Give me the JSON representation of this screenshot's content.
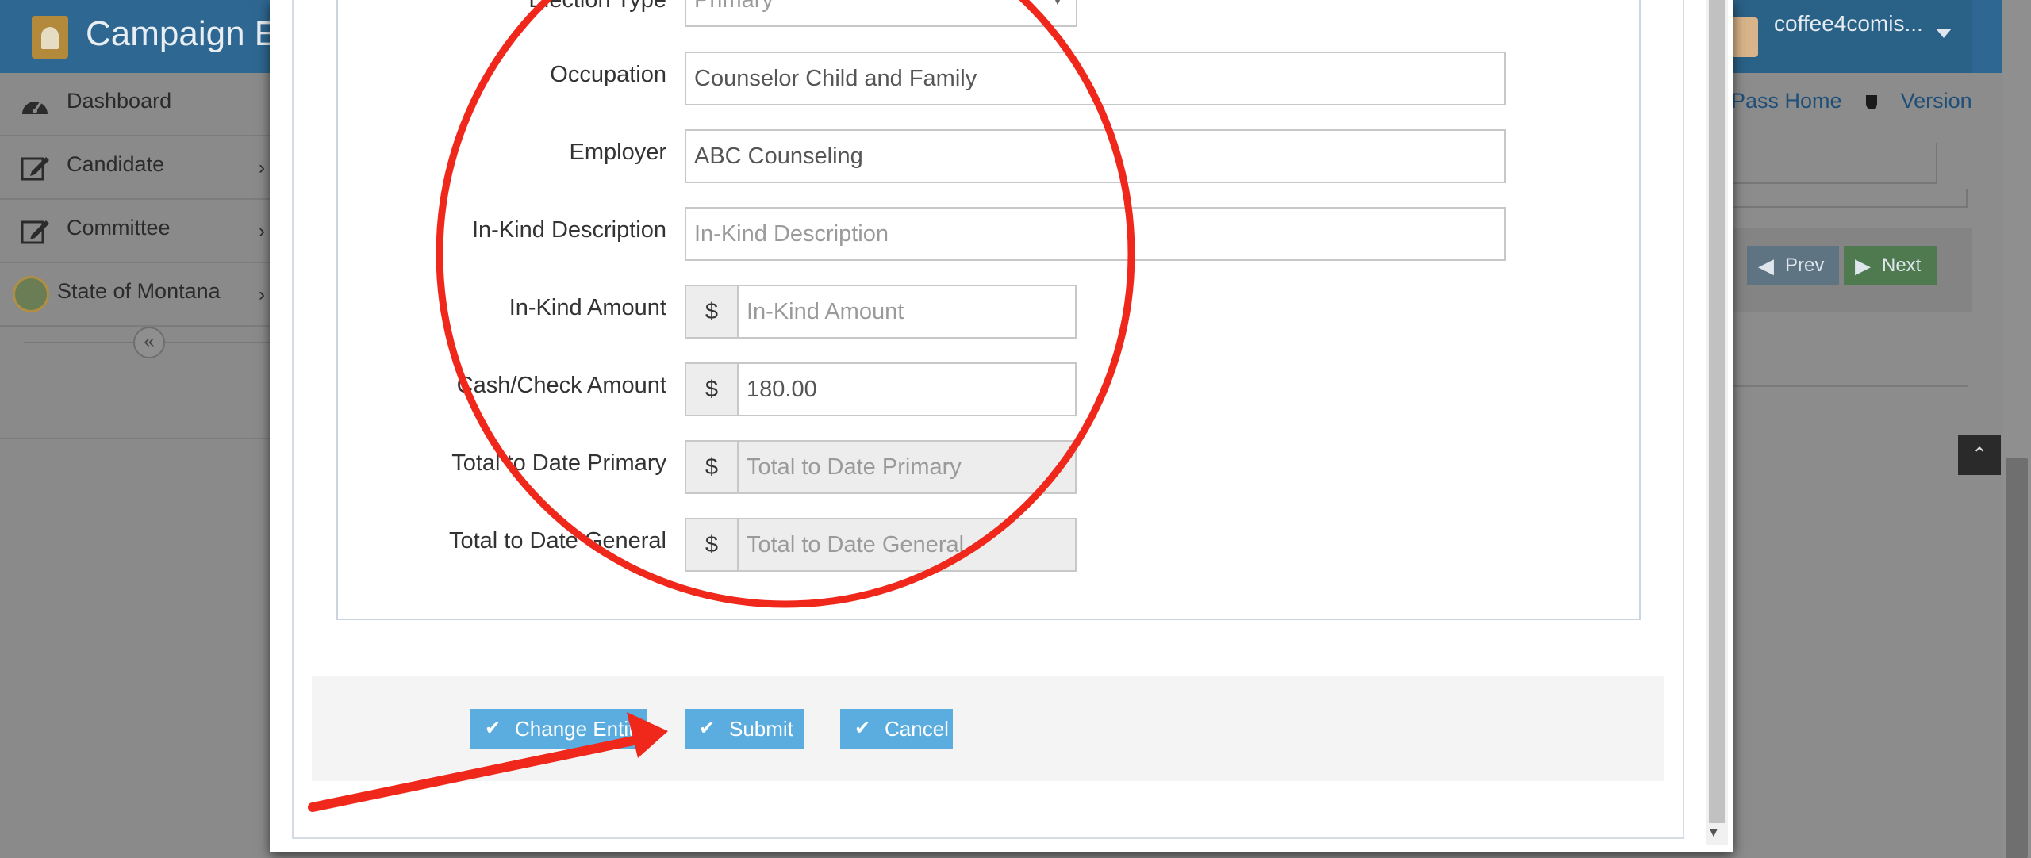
{
  "header": {
    "app_title": "Campaign El",
    "user_name": "coffee4comis..."
  },
  "sidebar": {
    "items": [
      {
        "label": "Dashboard",
        "icon": "dashboard-icon"
      },
      {
        "label": "Candidate",
        "icon": "edit-icon"
      },
      {
        "label": "Committee",
        "icon": "edit-icon"
      },
      {
        "label": "State of Montana",
        "icon": "state-seal-icon"
      }
    ],
    "collapse_glyph": "«"
  },
  "background_page": {
    "links": [
      "Pass Home",
      "Version"
    ],
    "prev_label": "Prev",
    "next_label": "Next",
    "to_top_glyph": "⌃"
  },
  "form": {
    "election_type": {
      "label": "Election Type",
      "value": "Primary"
    },
    "occupation": {
      "label": "Occupation",
      "value": "Counselor Child and Family"
    },
    "employer": {
      "label": "Employer",
      "value": "ABC Counseling"
    },
    "in_kind_description": {
      "label": "In-Kind Description",
      "placeholder": "In-Kind Description"
    },
    "in_kind_amount": {
      "label": "In-Kind Amount",
      "placeholder": "In-Kind Amount"
    },
    "cash_check_amount": {
      "label": "Cash/Check Amount",
      "value": "180.00"
    },
    "total_primary": {
      "label": "Total to Date Primary",
      "placeholder": "Total to Date Primary"
    },
    "total_general": {
      "label": "Total to Date General",
      "placeholder": "Total to Date General"
    },
    "currency_symbol": "$"
  },
  "actions": {
    "change_entity": "Change Entity",
    "submit": "Submit",
    "cancel": "Cancel"
  },
  "colors": {
    "header_blue": "#2e6791",
    "button_blue": "#5bacdf",
    "annotation_red": "#f0281c"
  }
}
